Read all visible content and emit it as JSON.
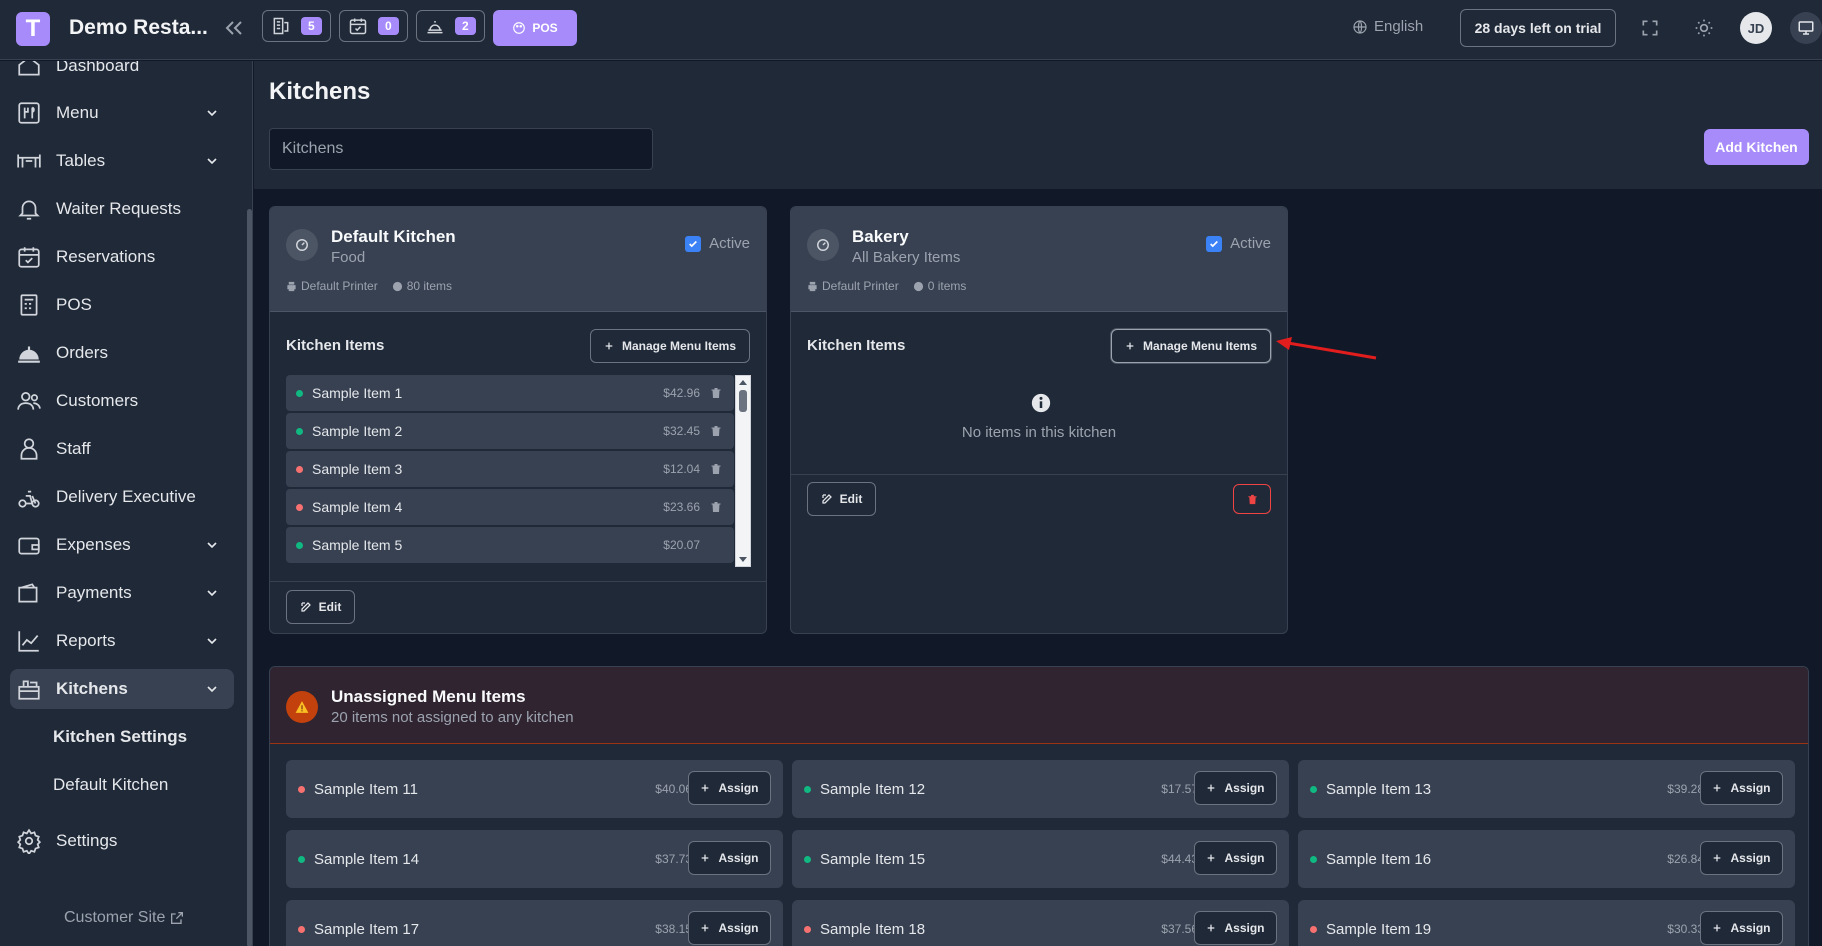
{
  "app": {
    "logo_letter": "T",
    "brand": "Demo Resta..."
  },
  "topbar": {
    "counter_buttons": [
      {
        "icon": "kitchen-order-icon",
        "count": "5"
      },
      {
        "icon": "calendar-check-icon",
        "count": "0"
      },
      {
        "icon": "waiter-icon",
        "count": "2"
      }
    ],
    "pos_label": "POS",
    "language": "English",
    "trial_label": "28 days left on trial",
    "avatar_initials": "JD"
  },
  "sidebar": {
    "items": [
      {
        "label": "Dashboard",
        "icon": "home-icon"
      },
      {
        "label": "Menu",
        "icon": "menu-icon",
        "expandable": true
      },
      {
        "label": "Tables",
        "icon": "table-icon",
        "expandable": true
      },
      {
        "label": "Waiter Requests",
        "icon": "bell-icon"
      },
      {
        "label": "Reservations",
        "icon": "calendar-icon"
      },
      {
        "label": "POS",
        "icon": "pos-icon"
      },
      {
        "label": "Orders",
        "icon": "cloche-icon"
      },
      {
        "label": "Customers",
        "icon": "users-icon"
      },
      {
        "label": "Staff",
        "icon": "user-icon"
      },
      {
        "label": "Delivery Executive",
        "icon": "scooter-icon"
      },
      {
        "label": "Expenses",
        "icon": "wallet-icon",
        "expandable": true
      },
      {
        "label": "Payments",
        "icon": "payments-icon",
        "expandable": true
      },
      {
        "label": "Reports",
        "icon": "chart-icon",
        "expandable": true
      },
      {
        "label": "Kitchens",
        "icon": "kitchen-icon",
        "expandable": true,
        "active": true
      }
    ],
    "sub_items": [
      "Kitchen Settings",
      "Default Kitchen"
    ],
    "settings": "Settings",
    "customer_site": "Customer Site"
  },
  "page": {
    "title": "Kitchens",
    "search_placeholder": "Kitchens",
    "add_kitchen": "Add Kitchen"
  },
  "kitchens": [
    {
      "name": "Default Kitchen",
      "type": "Food",
      "active_label": "Active",
      "printer": "Default Printer",
      "item_count": "80 items",
      "section_label": "Kitchen Items",
      "manage_label": "Manage Menu Items",
      "edit_label": "Edit",
      "items": [
        {
          "name": "Sample Item 1",
          "price": "$42.96",
          "status": "green"
        },
        {
          "name": "Sample Item 2",
          "price": "$32.45",
          "status": "green"
        },
        {
          "name": "Sample Item 3",
          "price": "$12.04",
          "status": "red"
        },
        {
          "name": "Sample Item 4",
          "price": "$23.66",
          "status": "red"
        },
        {
          "name": "Sample Item 5",
          "price": "$20.07",
          "status": "green"
        }
      ]
    },
    {
      "name": "Bakery",
      "type": "All Bakery Items",
      "active_label": "Active",
      "printer": "Default Printer",
      "item_count": "0 items",
      "section_label": "Kitchen Items",
      "manage_label": "Manage Menu Items",
      "edit_label": "Edit",
      "empty_text": "No items in this kitchen",
      "items": []
    }
  ],
  "unassigned": {
    "title": "Unassigned Menu Items",
    "subtitle": "20 items not assigned to any kitchen",
    "assign_label": "Assign",
    "items": [
      {
        "name": "Sample Item 11",
        "price": "$40.06",
        "status": "red"
      },
      {
        "name": "Sample Item 12",
        "price": "$17.57",
        "status": "green"
      },
      {
        "name": "Sample Item 13",
        "price": "$39.28",
        "status": "green"
      },
      {
        "name": "Sample Item 14",
        "price": "$37.73",
        "status": "green"
      },
      {
        "name": "Sample Item 15",
        "price": "$44.43",
        "status": "green"
      },
      {
        "name": "Sample Item 16",
        "price": "$26.84",
        "status": "green"
      },
      {
        "name": "Sample Item 17",
        "price": "$38.15",
        "status": "red"
      },
      {
        "name": "Sample Item 18",
        "price": "$37.56",
        "status": "red"
      },
      {
        "name": "Sample Item 19",
        "price": "$30.33",
        "status": "red"
      }
    ]
  },
  "colors": {
    "accent": "#a78bfa",
    "status_green": "#10b981",
    "status_red": "#f87171",
    "annotation_arrow": "#e11d1d"
  }
}
